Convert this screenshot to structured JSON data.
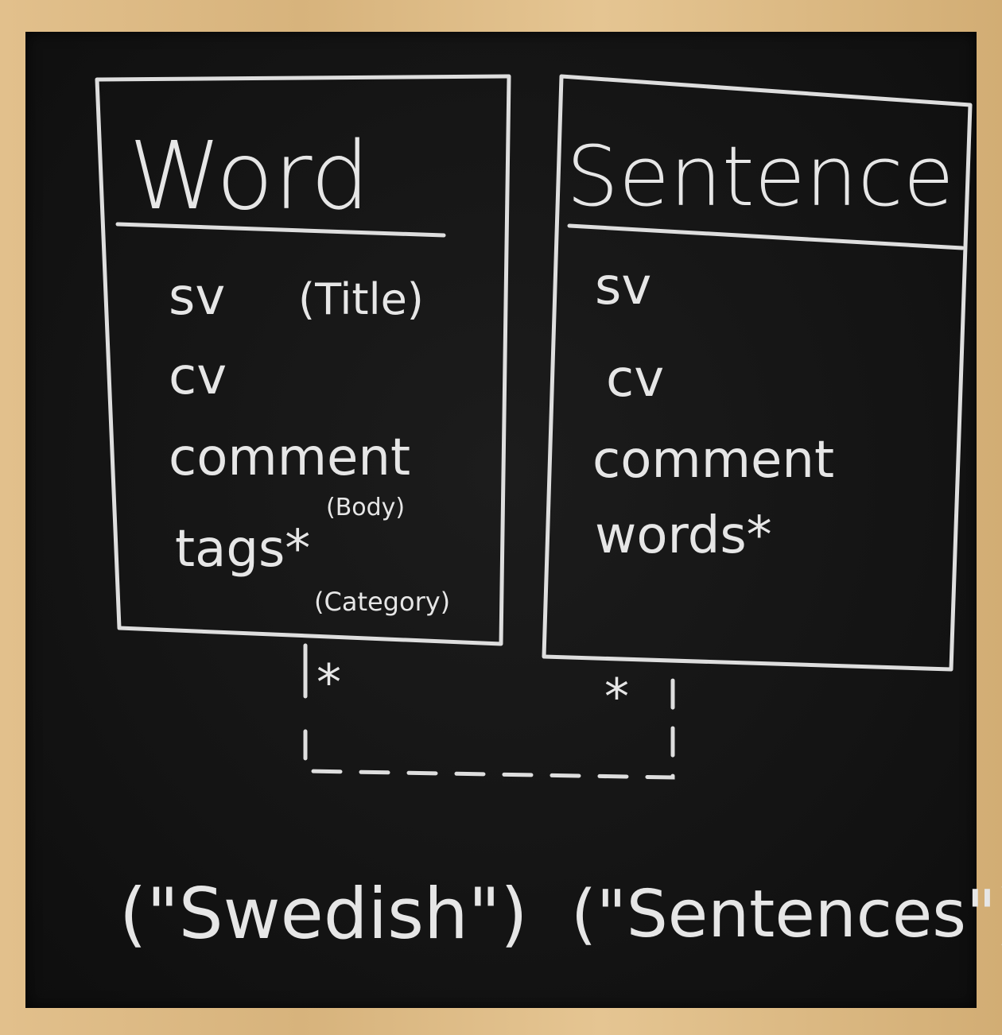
{
  "entities": [
    {
      "title": "Word",
      "attributes": [
        {
          "name": "sv",
          "note": "(Title)"
        },
        {
          "name": "cv",
          "note": ""
        },
        {
          "name": "comment",
          "note": "(Body)"
        },
        {
          "name": "tags*",
          "note": "(Category)"
        }
      ],
      "caption": "(\"Swedish\")"
    },
    {
      "title": "Sentence",
      "attributes": [
        {
          "name": "sv",
          "note": ""
        },
        {
          "name": "cv",
          "note": ""
        },
        {
          "name": "comment",
          "note": ""
        },
        {
          "name": "words*",
          "note": ""
        }
      ],
      "caption": "(\"Sentences\")"
    }
  ],
  "relationship": {
    "left_multiplicity": "*",
    "right_multiplicity": "*",
    "line_style": "dashed"
  },
  "colors": {
    "board": "#141414",
    "chalk": "#e6e6e6",
    "frame": "#d9b984"
  }
}
